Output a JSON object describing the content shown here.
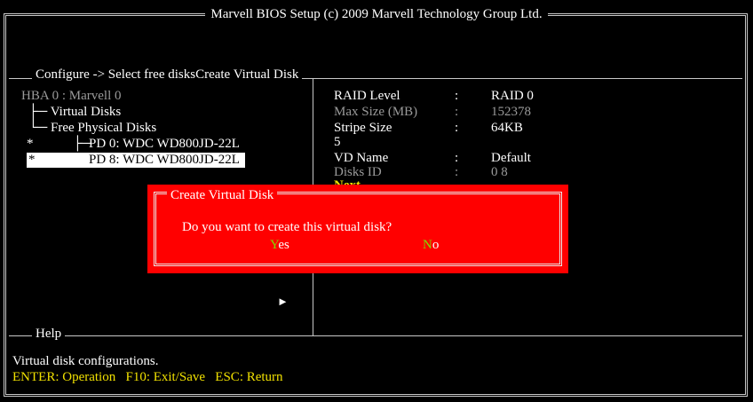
{
  "window": {
    "title": "Marvell BIOS Setup (c) 2009 Marvell Technology Group Ltd."
  },
  "breadcrumb": "Configure -> Select free disksCreate Virtual Disk",
  "tree": {
    "hba": "HBA  0 :  Marvell 0",
    "virtual_disks": "Virtual Disks",
    "free_physical_disks": "Free Physical Disks",
    "disks": [
      {
        "marker": "*",
        "label": "PD 0: WDC WD800JD-22L",
        "selected": false
      },
      {
        "marker": "*",
        "label": "PD 8: WDC WD800JD-22L",
        "selected": true
      }
    ]
  },
  "properties": [
    {
      "label": "RAID Level",
      "sep": ":",
      "value": "RAID  0",
      "dim": false
    },
    {
      "label": "Max Size (MB)",
      "sep": ":",
      "value": "152378",
      "dim": true
    },
    {
      "label": "Stripe Size",
      "sep": ":",
      "value": "64KB",
      "dim": false
    },
    {
      "label": "5",
      "sep": "",
      "value": "",
      "dim": false
    },
    {
      "label": "VD Name",
      "sep": ":",
      "value": "Default",
      "dim": false
    },
    {
      "label": "Disks ID",
      "sep": ":",
      "value": "0 8",
      "dim": true
    }
  ],
  "next_label": "Next",
  "arrow_glyph": "►",
  "dialog": {
    "title": "Create Virtual Disk",
    "message": "Do you want to create this virtual disk?",
    "yes_hotkey": "Y",
    "yes_rest": "es",
    "no_hotkey": "N",
    "no_rest": "o"
  },
  "help": {
    "label": "Help",
    "text": "Virtual disk configurations.",
    "keys": "ENTER: Operation   F10: Exit/Save   ESC: Return"
  },
  "colors": {
    "background": "#000000",
    "dialog": "#ff0000",
    "hotkey": "#7dde00",
    "help_keys": "#f0e000"
  }
}
